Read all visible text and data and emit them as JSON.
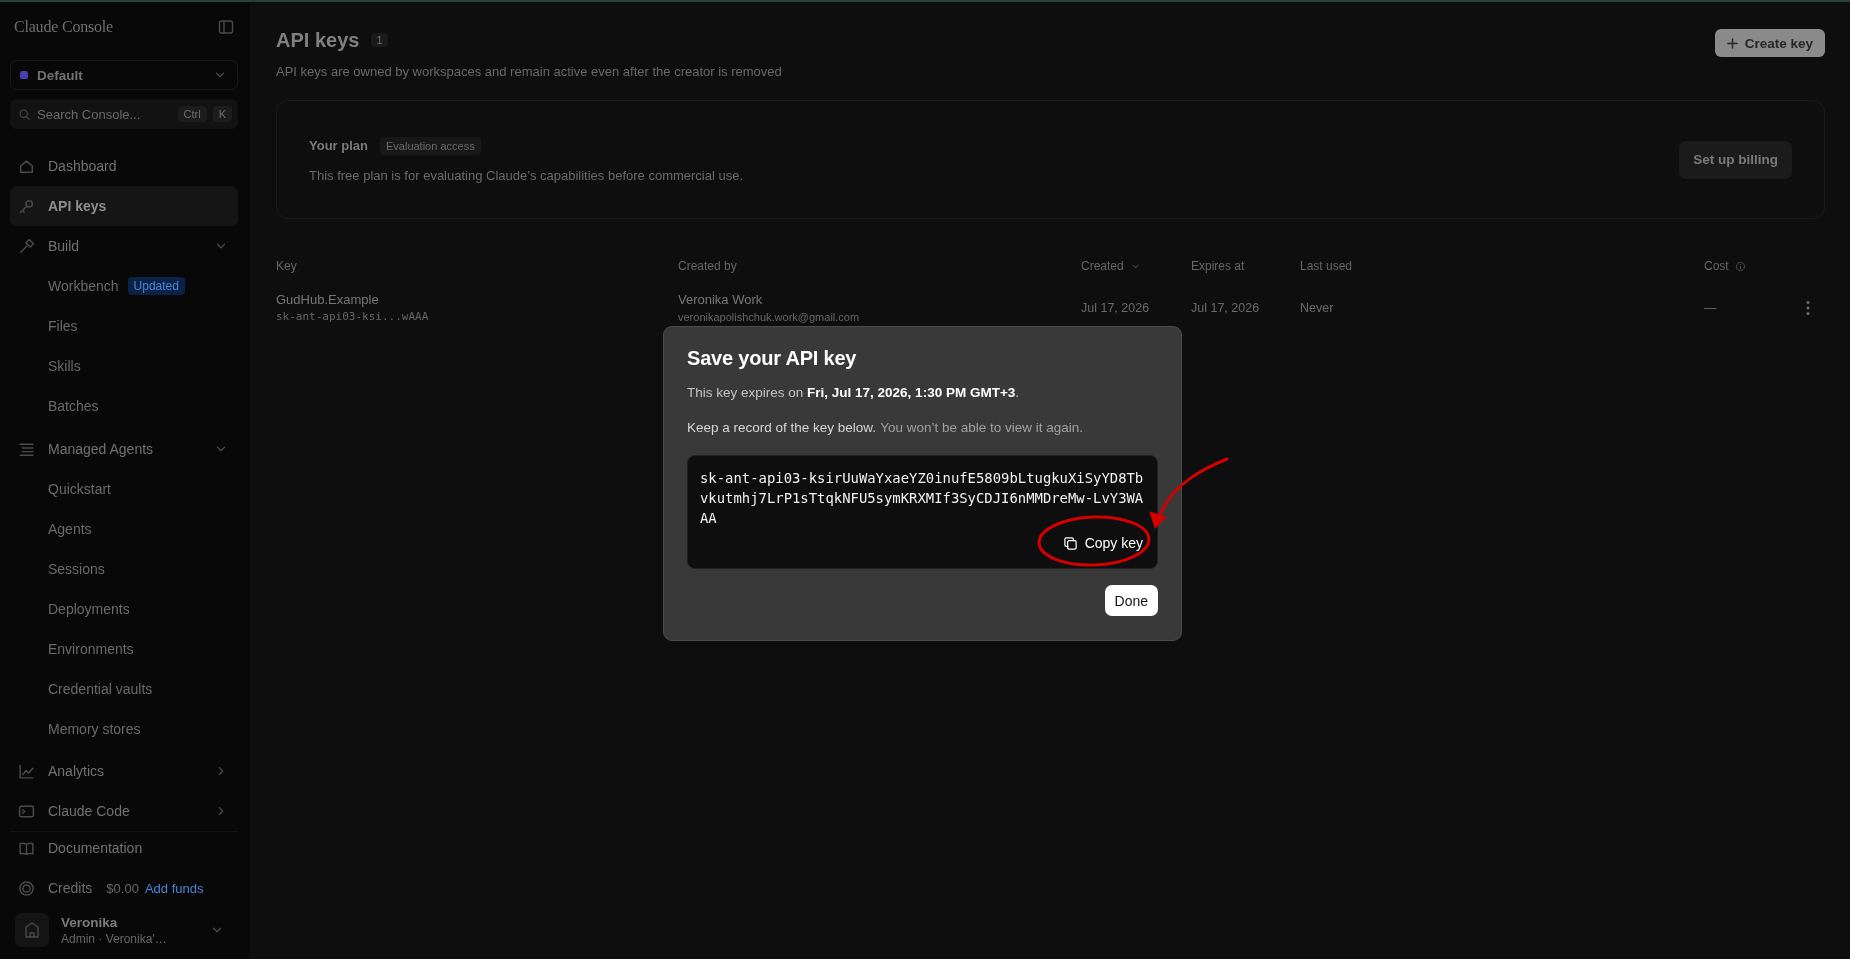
{
  "sidebar": {
    "title": "Claude Console",
    "workspace": "Default",
    "search": {
      "placeholder": "Search Console...",
      "shortcut": [
        "Ctrl",
        "K"
      ]
    },
    "nav": [
      {
        "label": "Dashboard",
        "selected": false
      },
      {
        "label": "API keys",
        "selected": true
      },
      {
        "label": "Build",
        "selected": false,
        "expanded": true,
        "children": [
          {
            "label": "Workbench",
            "badge": "Updated",
            "selected": false
          },
          {
            "label": "Files",
            "selected": false
          },
          {
            "label": "Skills",
            "selected": false
          },
          {
            "label": "Batches",
            "selected": false
          }
        ]
      },
      {
        "label": "Managed Agents",
        "selected": false,
        "expanded": true,
        "children": [
          {
            "label": "Quickstart",
            "selected": false
          },
          {
            "label": "Agents",
            "selected": false
          },
          {
            "label": "Sessions",
            "selected": false
          },
          {
            "label": "Deployments",
            "selected": false
          },
          {
            "label": "Environments",
            "selected": false
          },
          {
            "label": "Credential vaults",
            "selected": false
          },
          {
            "label": "Memory stores",
            "selected": false
          }
        ]
      },
      {
        "label": "Analytics",
        "selected": false,
        "expanded": false
      },
      {
        "label": "Claude Code",
        "selected": false,
        "expanded": false
      }
    ],
    "documentation": "Documentation",
    "credits": {
      "label": "Credits",
      "amount": "$0.00",
      "link": "Add funds"
    },
    "user": {
      "name": "Veronika",
      "role": "Admin · Veronika'…"
    }
  },
  "header": {
    "title": "API keys",
    "count": "1",
    "subtitle": "API keys are owned by workspaces and remain active even after the creator is removed",
    "create_button": "Create key"
  },
  "plan": {
    "title": "Your plan",
    "badge": "Evaluation access",
    "description": "This free plan is for evaluating Claude’s capabilities before commercial use.",
    "button": "Set up billing"
  },
  "table": {
    "columns": [
      {
        "label": "Key",
        "sorted": false
      },
      {
        "label": "Created by",
        "sorted": false
      },
      {
        "label": "Created",
        "sorted": true
      },
      {
        "label": "Expires at",
        "sorted": false
      },
      {
        "label": "Last used",
        "sorted": false
      },
      {
        "label": "Cost",
        "sorted": false
      }
    ],
    "rows": [
      {
        "name": "GudHub.Example",
        "key": "sk-ant-api03-ksi...wAAA",
        "created_by": "Veronika Work",
        "email": "veronikapolishchuk.work@gmail.com",
        "created": "Jul 17, 2026",
        "expires": "Jul 17, 2026",
        "last_used": "Never",
        "cost": "—"
      }
    ]
  },
  "dialog": {
    "title": "Save your API key",
    "expiry": "This key expires on **Fri, Jul 17, 2026, 1:30 PM GMT+3**.",
    "instruction": "Keep a record of the key below.",
    "warning": "You won’t be able to view it again.",
    "key": "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",
    "copy_button": "Copy key",
    "done_button": "Done"
  }
}
